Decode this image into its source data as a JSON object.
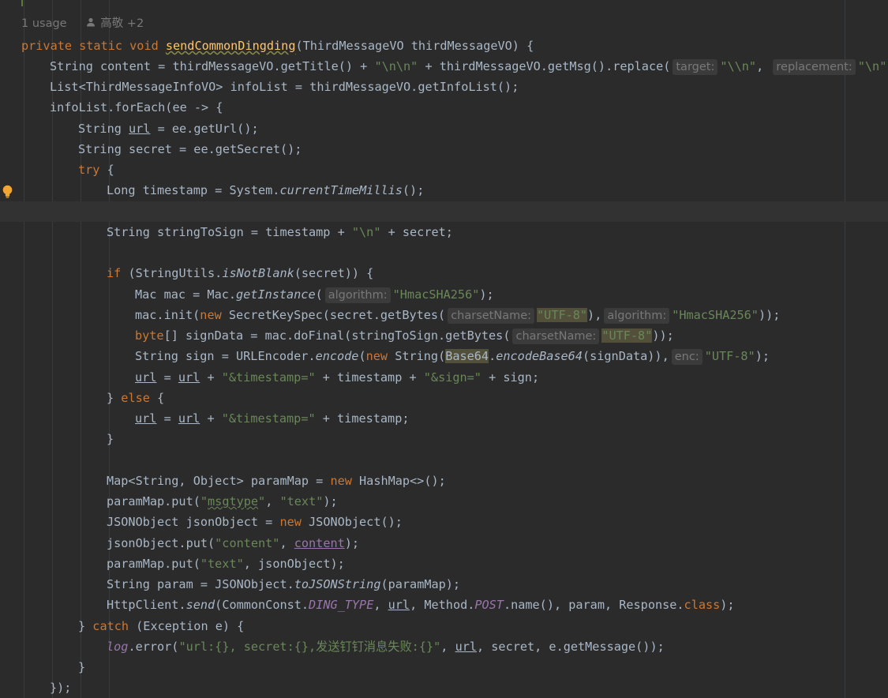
{
  "usage": {
    "count": "1 usage",
    "authors": "高敬 +2"
  },
  "code": {
    "line01": {
      "t1": "private static void ",
      "method": "sendCommonDingding",
      "t2": "(ThirdMessageVO thirdMessageVO) {"
    },
    "line02": {
      "t1": "String content = thirdMessageVO.getTitle() + ",
      "s1": "\"\\n\\n\"",
      "t2": " + thirdMessageVO.getMsg().replace(",
      "h1": "target:",
      "s2": "\"\\\\n\"",
      "t3": ", ",
      "h2": "replacement:",
      "s3": "\"\\n\"",
      "t4": ");"
    },
    "line03": {
      "t1": "List<ThirdMessageInfoVO> infoList = thirdMessageVO.getInfoList();"
    },
    "line04": {
      "t1": "infoList.forEach(ee -> {"
    },
    "line05": {
      "t1": "String ",
      "v": "url",
      "t2": " = ee.getUrl();"
    },
    "line06": {
      "t1": "String secret = ee.getSecret();"
    },
    "line07": {
      "k": "try",
      "t1": " {"
    },
    "line08": {
      "t1": "Long timestamp = System.",
      "s": "currentTimeMillis",
      "t2": "();"
    },
    "line10": {
      "t1": "String stringToSign = timestamp + ",
      "s1": "\"\\n\"",
      "t2": " + secret;"
    },
    "line12": {
      "k": "if",
      "t1": " (StringUtils.",
      "s": "isNotBlank",
      "t2": "(secret)) {"
    },
    "line13": {
      "t1": "Mac mac = Mac.",
      "s": "getInstance",
      "t2": "(",
      "h1": "algorithm:",
      "s1": "\"HmacSHA256\"",
      "t3": ");"
    },
    "line14": {
      "t1": "mac.init(",
      "k": "new",
      "t2": " SecretKeySpec(secret.getBytes(",
      "h1": "charsetName:",
      "s1": "\"UTF-8\"",
      "t3": "),",
      "h2": "algorithm:",
      "s2": "\"HmacSHA256\"",
      "t4": "));"
    },
    "line15": {
      "k": "byte",
      "t1": "[] signData = mac.doFinal(stringToSign.getBytes(",
      "h1": "charsetName:",
      "s1": "\"UTF-8\"",
      "t2": "));"
    },
    "line16": {
      "t1": "String sign = URLEncoder.",
      "s": "encode",
      "t2": "(",
      "k": "new",
      "t3": " String(",
      "hl": "Base64",
      "t4": ".",
      "s2": "encodeBase64",
      "t5": "(signData)),",
      "h1": "enc:",
      "s1": "\"UTF-8\"",
      "t6": ");"
    },
    "line17": {
      "v1": "url",
      "t1": " = ",
      "v2": "url",
      "t2": " + ",
      "s1": "\"&timestamp=\"",
      "t3": " + timestamp + ",
      "s2": "\"&sign=\"",
      "t4": " + sign;"
    },
    "line18": {
      "t1": "} ",
      "k": "else",
      "t2": " {"
    },
    "line19": {
      "v1": "url",
      "t1": " = ",
      "v2": "url",
      "t2": " + ",
      "s1": "\"&timestamp=\"",
      "t3": " + timestamp;"
    },
    "line20": {
      "t1": "}"
    },
    "line22": {
      "t1": "Map<String, Object> paramMap = ",
      "k": "new",
      "t2": " HashMap<>();"
    },
    "line23": {
      "t1": "paramMap.put(",
      "s1a": "\"",
      "s1b": "msgtype",
      "s1c": "\"",
      "t2": ", ",
      "s2": "\"text\"",
      "t3": ");"
    },
    "line24": {
      "t1": "JSONObject jsonObject = ",
      "k": "new",
      "t2": " JSONObject();"
    },
    "line25": {
      "t1": "jsonObject.put(",
      "s1": "\"content\"",
      "t2": ", ",
      "v": "content",
      "t3": ");"
    },
    "line26": {
      "t1": "paramMap.put(",
      "s1": "\"text\"",
      "t2": ", jsonObject);"
    },
    "line27": {
      "t1": "String param = JSONObject.",
      "s": "toJSONString",
      "t2": "(paramMap);"
    },
    "line28": {
      "t1": "HttpClient.",
      "s": "send",
      "t2": "(CommonConst.",
      "c": "DING_TYPE",
      "t3": ", ",
      "v": "url",
      "t4": ", Method.",
      "c2": "POST",
      "t5": ".name(), param, Response.",
      "k": "class",
      "t6": ");"
    },
    "line29": {
      "t1": "} ",
      "k": "catch",
      "t2": " (Exception e) {"
    },
    "line30": {
      "c": "log",
      "t1": ".error(",
      "s1": "\"url:{}, secret:{},发送钉钉消息失败:{}\"",
      "t2": ", ",
      "v": "url",
      "t3": ", secret, e.getMessage());"
    },
    "line31": {
      "t1": "}"
    },
    "line32": {
      "t1": "});"
    }
  },
  "colors": {
    "background": "#2b2b2b",
    "current_line": "#323232",
    "keyword": "#cc7832",
    "string": "#6a8759",
    "method_decl": "#ffc66d",
    "field": "#9876aa",
    "default_text": "#a9b7c6",
    "hint": "#787878"
  }
}
